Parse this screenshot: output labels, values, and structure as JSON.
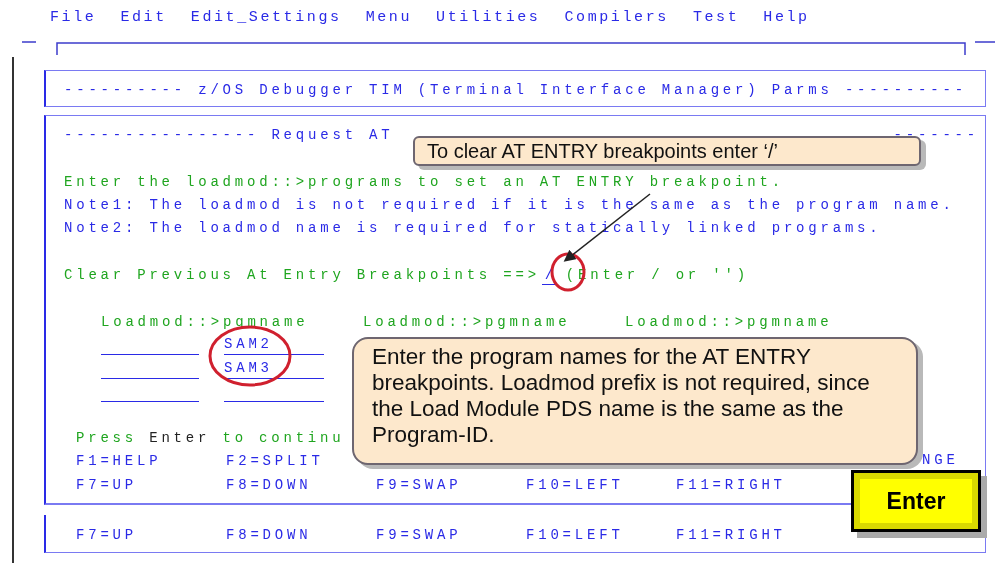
{
  "menu_bar": {
    "items": [
      "File",
      "Edit",
      "Edit_Settings",
      "Menu",
      "Utilities",
      "Compilers",
      "Test",
      "Help"
    ]
  },
  "title_panel": {
    "title": "---------- z/OS Debugger TIM (Terminal Interface Manager) Parms ----------"
  },
  "main_panel": {
    "heading_left": "---------------- Request AT",
    "heading_right": "-------",
    "instructions": [
      {
        "kind": "prompt",
        "text": "Enter the loadmod::>programs to set an AT ENTRY breakpoint."
      },
      {
        "kind": "note",
        "text": "Note1: The loadmod is not required if it is the same as the program name."
      },
      {
        "kind": "note",
        "text": "Note2: The loadmod name is required for statically linked programs."
      }
    ],
    "clear_prompt": {
      "label": "Clear Previous At Entry Breakpoints ==>",
      "value": "/",
      "hint": "(Enter / or '')"
    },
    "column_headers": [
      "Loadmod::>pgmname",
      "Loadmod::>pgmname",
      "Loadmod::>pgmname"
    ],
    "entry_rows": [
      {
        "pgmname": "SAM2"
      },
      {
        "pgmname": "SAM3"
      },
      {}
    ],
    "press_enter": {
      "before": "Press",
      "key": "Enter",
      "after": "to continu"
    },
    "function_key_rows": [
      [
        "F1=HELP",
        "F2=SPLIT"
      ],
      [
        "F7=UP",
        "F8=DOWN",
        "F9=SWAP",
        "F10=LEFT",
        "F11=RIGHT"
      ]
    ],
    "partial_key": "NGE"
  },
  "bottom_panel": {
    "function_keys": [
      "F7=UP",
      "F8=DOWN",
      "F9=SWAP",
      "F10=LEFT",
      "F11=RIGHT"
    ]
  },
  "callouts": [
    {
      "kind": "small",
      "text": "To clear AT ENTRY  breakpoints enter ‘/’"
    },
    {
      "kind": "large",
      "text": "Enter the program names for the AT ENTRY breakpoints. Loadmod prefix is not required, since the Load Module PDS name is the same as the Program-ID."
    }
  ],
  "enter_key": {
    "label": "Enter"
  }
}
